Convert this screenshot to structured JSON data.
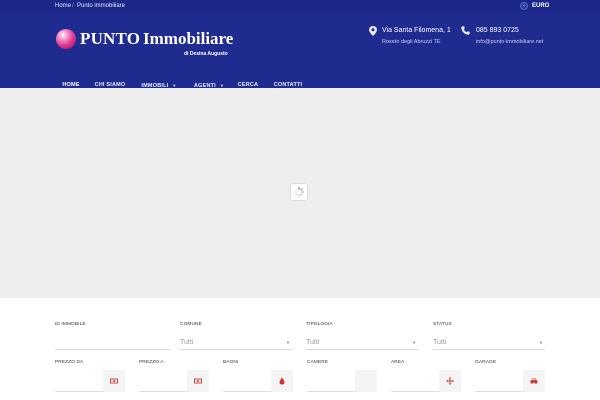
{
  "topbar": {
    "breadcrumb": [
      "Home",
      "Punto immobiliare"
    ],
    "currency_label": "EURO",
    "currency_icon": "chevron-left-icon"
  },
  "header": {
    "logo_word1": "PUNTO",
    "logo_word2": "Immobiliare",
    "logo_sub": "di Desina Augusto",
    "address_line1": "Via Santa Filomena, 1",
    "address_line2": "Roseto degli Abruzzi TE",
    "phone": "085 893 0725",
    "email": "info@punto-immobiliare.net",
    "address_icon": "map-pin-icon",
    "phone_icon": "phone-icon"
  },
  "nav": {
    "items": [
      {
        "label": "HOME",
        "active": true
      },
      {
        "label": "CHI SIAMO"
      },
      {
        "label": "IMMOBILI",
        "dropdown": true
      },
      {
        "label": "AGENTI",
        "dropdown": true
      },
      {
        "label": "CERCA"
      },
      {
        "label": "CONTATTI"
      }
    ],
    "caret": "▼"
  },
  "search": {
    "row1": [
      {
        "label": "ID IMMOBILE",
        "value": ""
      },
      {
        "label": "COMUNE",
        "value": "Tutti"
      },
      {
        "label": "TIPOLOGIA",
        "value": "Tutti"
      },
      {
        "label": "STATUS",
        "value": "Tutti"
      }
    ],
    "row2": [
      {
        "label": "PREZZO DA",
        "icon": "money-icon"
      },
      {
        "label": "PREZZO A",
        "icon": "money-icon"
      },
      {
        "label": "BAGNI",
        "icon": "drop-icon"
      },
      {
        "label": "CAMERE",
        "icon": "bed-icon"
      },
      {
        "label": "AREA",
        "icon": "expand-arrows-icon"
      },
      {
        "label": "GARAGE",
        "icon": "car-icon"
      }
    ]
  },
  "colors": {
    "header_bg": "#1f2b8f",
    "topbar_bg": "#1b2688",
    "accent": "#e0358f",
    "icon_red": "#d6312b"
  }
}
